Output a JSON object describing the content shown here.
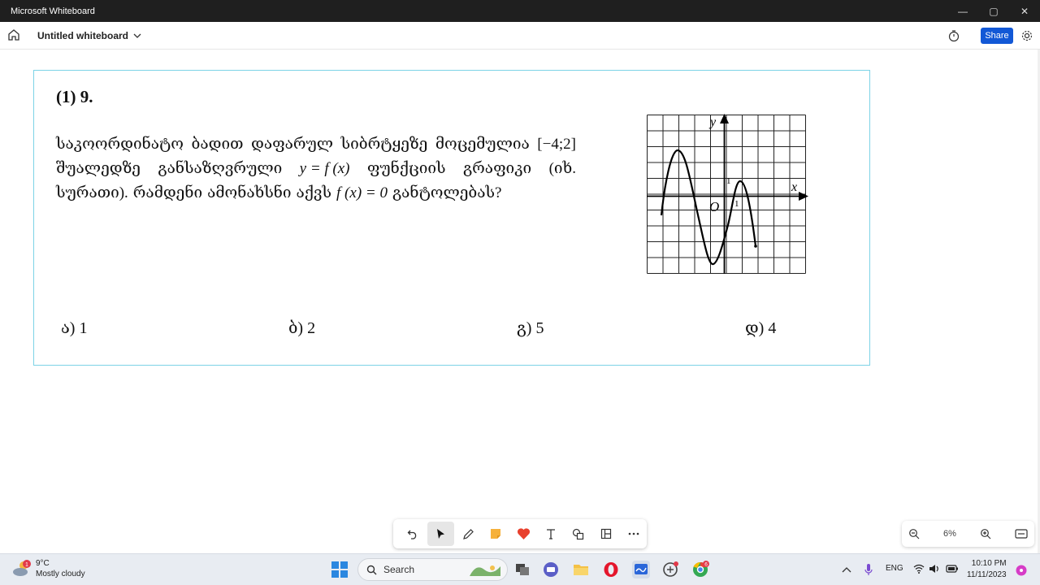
{
  "window": {
    "title": "Microsoft Whiteboard",
    "minimize": "—",
    "maximize": "▢",
    "close": "✕"
  },
  "appbar": {
    "whiteboard_name": "Untitled whiteboard",
    "share_label": "Share"
  },
  "question": {
    "number": "(1) 9.",
    "line1_words": [
      "საკოორდინატო",
      "ბადით",
      "დაფარულ",
      "სიბრტყეზე",
      "მოცემულია",
      "[−4;2]"
    ],
    "line2_words": [
      "შუალედზე",
      "განსაზღვრული",
      "y = f (x)",
      "ფუნქციის",
      "გრაფიკი",
      "(იხ."
    ],
    "line3_words": [
      "სურათი).",
      "რამდენი",
      "ამონახსნი",
      "აქვს",
      "f (x) = 0",
      "განტოლებას?"
    ]
  },
  "graph": {
    "y_label": "y",
    "x_label": "x",
    "origin_label": "O",
    "tick_y": "1",
    "tick_x": "1"
  },
  "answers": [
    {
      "label": "ა) 1"
    },
    {
      "label": "ბ) 2"
    },
    {
      "label": "გ) 5"
    },
    {
      "label": "დ) 4"
    }
  ],
  "zoom": {
    "level": "6%"
  },
  "taskbar": {
    "temperature": "9°C",
    "weather": "Mostly cloudy",
    "weather_badge": "1",
    "search_placeholder": "Search",
    "language": "ENG",
    "time": "10:10 PM",
    "date": "11/11/2023",
    "chrome_badge": "6"
  },
  "colors": {
    "accent": "#1258d6",
    "card_border": "#7dd3e6",
    "titlebar": "#1f1f1f"
  }
}
